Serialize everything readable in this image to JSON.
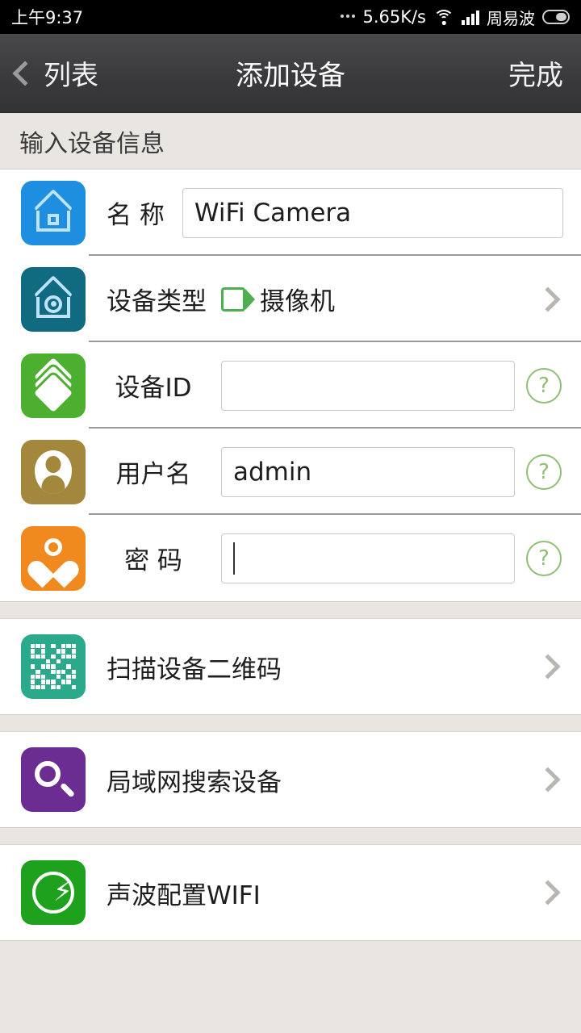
{
  "statusbar": {
    "time": "上午9:37",
    "network_speed": "5.65K/s",
    "carrier": "周易波",
    "wifi_icon": "wifi-icon",
    "signal_icon": "signal-bars-icon",
    "battery_icon": "battery-icon"
  },
  "navbar": {
    "back_label": "列表",
    "title": "添加设备",
    "done_label": "完成",
    "back_icon": "chevron-left-icon"
  },
  "section": {
    "header": "输入设备信息"
  },
  "form": {
    "name": {
      "label": "名 称",
      "value": "WiFi Camera",
      "placeholder": "",
      "icon": "home-icon",
      "icon_color": "#1e8fe0"
    },
    "device_type": {
      "label": "设备类型",
      "value": "摄像机",
      "icon": "home-camera-icon",
      "icon_color": "#116b80",
      "value_icon": "video-camera-icon",
      "value_icon_color": "#4caf50",
      "chevron": "chevron-right-icon"
    },
    "device_id": {
      "label": "设备ID",
      "value": "",
      "placeholder": "",
      "icon": "layers-icon",
      "icon_color": "#4caf2f",
      "help": "?"
    },
    "username": {
      "label": "用户名",
      "value": "admin",
      "placeholder": "",
      "icon": "user-icon",
      "icon_color": "#a3873c",
      "help": "?"
    },
    "password": {
      "label": "密 码",
      "value": "",
      "placeholder": "",
      "icon": "heart-lock-icon",
      "icon_color": "#f08a1e",
      "help": "?"
    }
  },
  "actions": [
    {
      "label": "扫描设备二维码",
      "icon": "qr-code-icon",
      "icon_color": "#2aa98b",
      "chevron": "chevron-right-icon"
    },
    {
      "label": "局域网搜索设备",
      "icon": "magnifier-icon",
      "icon_color": "#6b2d91",
      "chevron": "chevron-right-icon"
    },
    {
      "label": "声波配置WIFI",
      "icon": "lightning-icon",
      "icon_color": "#1ea21e",
      "chevron": "chevron-right-icon"
    }
  ],
  "colors": {
    "page_bg": "#e9e6e1",
    "card_bg": "#ffffff",
    "navbar_bg": "#3a3a3c",
    "statusbar_bg": "#000000",
    "help_green": "#8fbf74",
    "divider": "#9b9b9b"
  }
}
